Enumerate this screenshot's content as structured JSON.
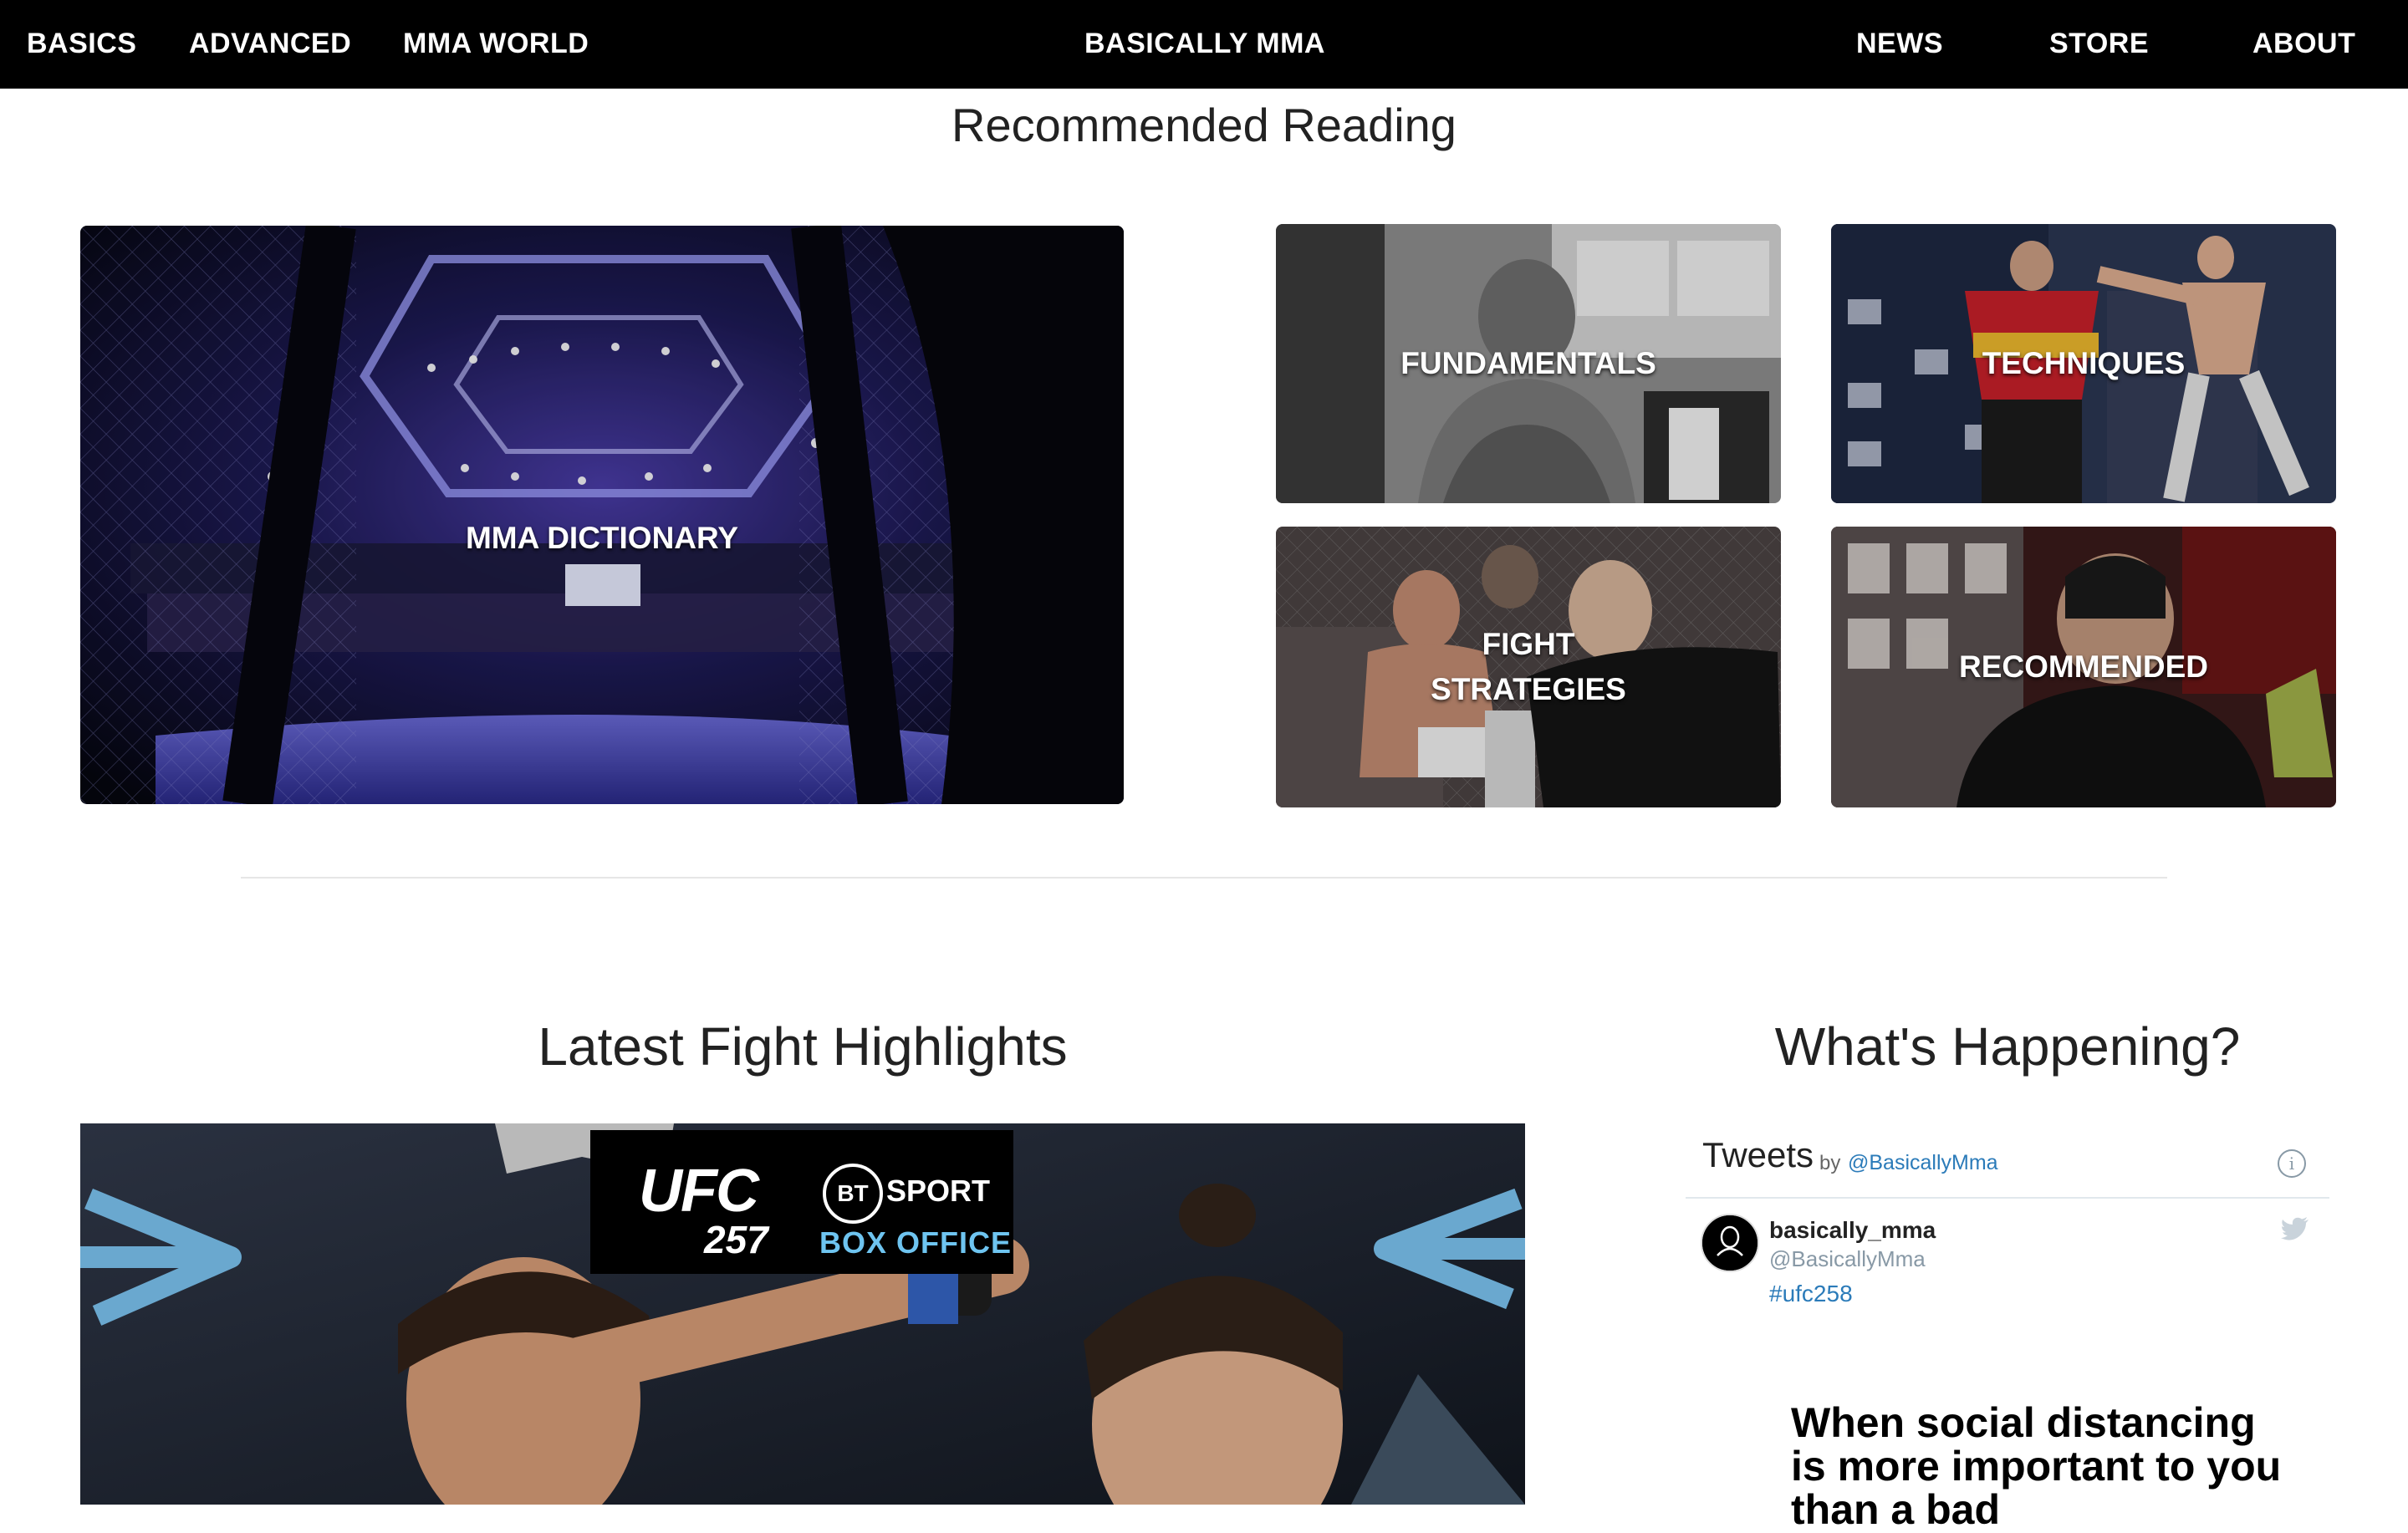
{
  "nav": {
    "left": [
      "BASICS",
      "ADVANCED",
      "MMA WORLD"
    ],
    "brand": "BASICALLY MMA",
    "right": [
      "NEWS",
      "STORE",
      "ABOUT"
    ]
  },
  "recommended": {
    "heading": "Recommended Reading",
    "tiles": [
      {
        "label": "MMA DICTIONARY"
      },
      {
        "label": "FUNDAMENTALS"
      },
      {
        "label": "TECHNIQUES"
      },
      {
        "label": "FIGHT\nSTRATEGIES"
      },
      {
        "label": "RECOMMENDED"
      }
    ]
  },
  "highlights": {
    "heading": "Latest Fight Highlights",
    "video": {
      "ufc_logo": "UFC",
      "ufc_number": "257",
      "bt_mark": "BT",
      "bt_sport": "SPORT",
      "bt_box_office": "BOX OFFICE"
    }
  },
  "happening": {
    "heading": "What's Happening?",
    "twitter": {
      "title": "Tweets",
      "by": "by",
      "handle_link": "@BasicallyMma",
      "info_glyph": "i",
      "tweet": {
        "name": "basically_mma",
        "username": "@BasicallyMma",
        "hashtag": "#ufc258",
        "meme_text": "When social distancing is more important to you than a bad"
      }
    }
  },
  "colors": {
    "nav_bg": "#000000",
    "link_blue": "#2b7bb9",
    "divider": "#e6e6e6"
  }
}
